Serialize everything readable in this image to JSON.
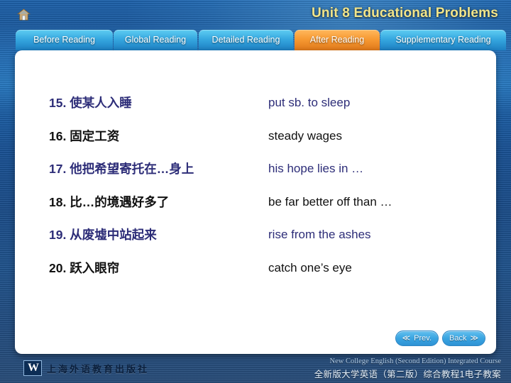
{
  "header": {
    "home_icon": "home-icon",
    "unit_title": "Unit 8 Educational Problems"
  },
  "tabs": [
    {
      "label": "Before Reading",
      "active": false
    },
    {
      "label": "Global Reading",
      "active": false
    },
    {
      "label": "Detailed Reading",
      "active": false
    },
    {
      "label": "After Reading",
      "active": true
    },
    {
      "label": "Supplementary Reading",
      "active": false
    }
  ],
  "content": {
    "rows": [
      {
        "chinese": "15. 使某人入睡",
        "english": "put sb. to sleep",
        "color": "navy"
      },
      {
        "chinese": "16. 固定工资",
        "english": "steady wages",
        "color": "black"
      },
      {
        "chinese": "17. 他把希望寄托在…身上",
        "english": "his hope lies in …",
        "color": "navy"
      },
      {
        "chinese": "18. 比…的境遇好多了",
        "english": "be far better off than …",
        "color": "black"
      },
      {
        "chinese": "19. 从废墟中站起来",
        "english": "rise from the ashes",
        "color": "navy"
      },
      {
        "chinese": "20. 跃入眼帘",
        "english": "catch one’s eye",
        "color": "black"
      }
    ]
  },
  "navigation": {
    "prev": {
      "label": "Prev.",
      "icon": "double-chevron-left-icon",
      "glyph": "≪"
    },
    "back": {
      "label": "Back",
      "icon": "double-chevron-right-icon",
      "glyph": "≫"
    }
  },
  "footer": {
    "logo_mark": "W",
    "publisher_cn": "上海外语教育出版社",
    "course_en": "New College English (Second Edition) Integrated Course",
    "course_cn": "全新版大学英语（第二版）综合教程1电子教案"
  },
  "colors": {
    "background_blue": "#1d5fa6",
    "tab_blue": "#36a8e0",
    "tab_active_orange": "#f79a33",
    "title_yellow": "#f2e58a",
    "text_navy": "#2d2d78",
    "text_black": "#111111",
    "panel_white": "#ffffff"
  }
}
